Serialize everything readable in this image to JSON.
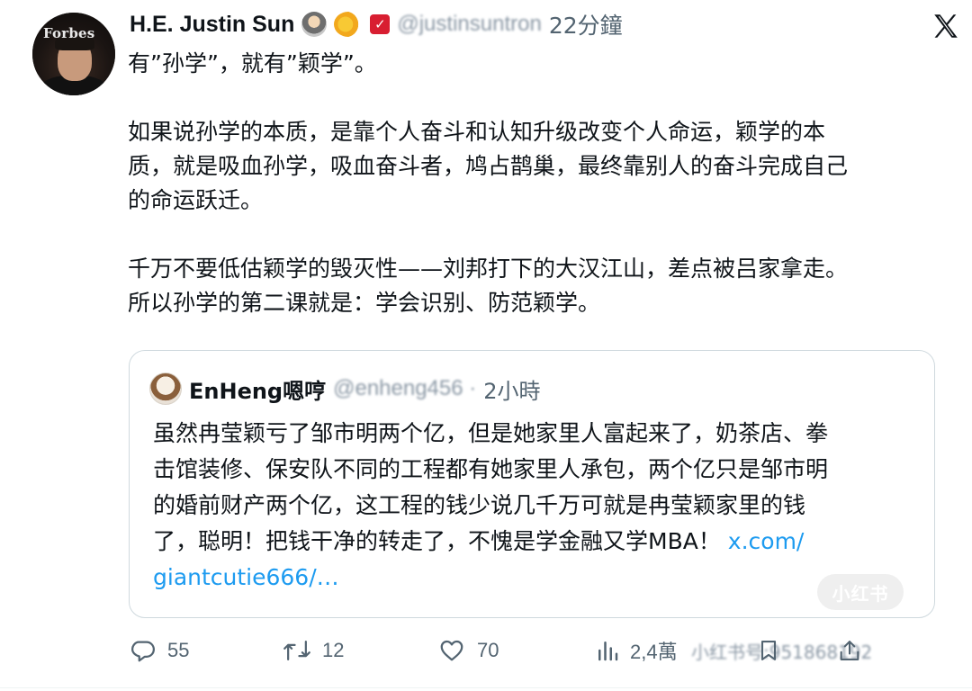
{
  "author": {
    "display_name": "H.E. Justin Sun",
    "avatar_brand": "Forbes",
    "handle": "@justinsuntron",
    "time": "22分鐘"
  },
  "tweet": {
    "paragraphs": [
      [
        "有”孙学”，就有”颖学”。"
      ],
      [
        "如果说孙学的本质，是靠个人奋斗和认知升级改变个人命运，颖学的本",
        "质，就是吸血孙学，吸血奋斗者，鸠占鹊巢，最终靠别人的奋斗完成自己",
        "的命运跃迁。"
      ],
      [
        "千万不要低估颖学的毁灭性——刘邦打下的大汉江山，差点被吕家拿走。",
        "所以孙学的第二课就是：学会识别、防范颖学。"
      ]
    ]
  },
  "quote": {
    "display_name": "EnHeng嗯哼",
    "handle": "@enheng456 · ",
    "time": "2小時",
    "lines": [
      "虽然冉莹颖亏了邹市明两个亿，但是她家里人富起来了，奶茶店、拳",
      "击馆装修、保安队不同的工程都有她家里人承包，两个亿只是邹市明",
      "的婚前财产两个亿，这工程的钱少说几千万可就是冉莹颖家里的钱",
      "了，聪明！把钱干净的转走了，不愧是学金融又学MBA！ "
    ],
    "link_part1": "x.com/",
    "link_part2": "giantcutie666/…",
    "watermark": "小红书"
  },
  "actions": {
    "replies": "55",
    "reposts": "12",
    "likes": "70",
    "views": "2,4萬",
    "overlay_watermark": "小红书号:951868192"
  },
  "colors": {
    "link": "#1d9bf0",
    "text": "#0f1419",
    "muted": "#536471",
    "verified_badge": "#d81e31"
  },
  "icons": [
    "x-logo-icon",
    "verified-badge-icon",
    "reply-icon",
    "repost-icon",
    "like-icon",
    "views-icon",
    "bookmark-icon",
    "share-icon"
  ]
}
